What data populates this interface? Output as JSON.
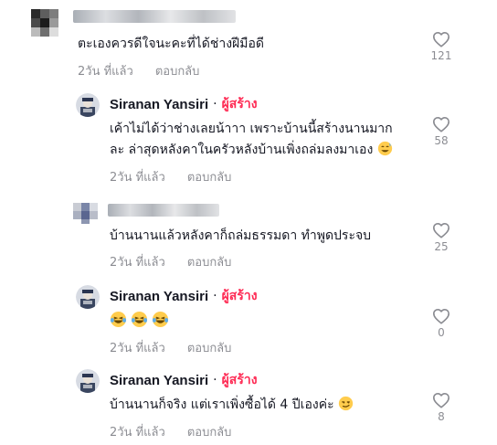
{
  "comments": [
    {
      "username": "",
      "text": "ตะเองควรดีใจนะคะที่ได้ช่างฝีมือดี",
      "time": "2วัน ที่แล้ว",
      "reply": "ตอบกลับ",
      "likes": "121"
    },
    {
      "username": "Siranan Yansiri",
      "badge": "ผู้สร้าง",
      "text_line1": "เค้าไม่ได้ว่าช่างเลยน้าาา เพราะบ้านนี้สร้างนานมาก",
      "text_line2": "ละ ล่าสุดหลังคาในครัวหลังบ้านเพิ่งถล่มลงมาเอง",
      "time": "2วัน ที่แล้ว",
      "reply": "ตอบกลับ",
      "likes": "58"
    },
    {
      "username": "",
      "text": "บ้านนานแล้วหลังคาก็ถล่มธรรมดา ทำพูดประจบ",
      "time": "2วัน ที่แล้ว",
      "reply": "ตอบกลับ",
      "likes": "25"
    },
    {
      "username": "Siranan Yansiri",
      "badge": "ผู้สร้าง",
      "text": "",
      "time": "2วัน ที่แล้ว",
      "reply": "ตอบกลับ",
      "likes": "0"
    },
    {
      "username": "Siranan Yansiri",
      "badge": "ผู้สร้าง",
      "text": "บ้านนานก็จริง แต่เราเพิ่งซื้อได้ 4 ปีเองค่ะ",
      "time": "2วัน ที่แล้ว",
      "reply": "ตอบกลับ",
      "likes": "8"
    }
  ],
  "dot_separator": "·",
  "colors": {
    "creator_badge": "#fe2c55",
    "meta_text": "#8a8b91",
    "text": "#161823"
  },
  "icons": {
    "like": "heart-outline-icon",
    "laugh": "laughing-tears-emoji",
    "sweat": "sweat-smile-emoji",
    "smirk": "smirk-emoji"
  }
}
